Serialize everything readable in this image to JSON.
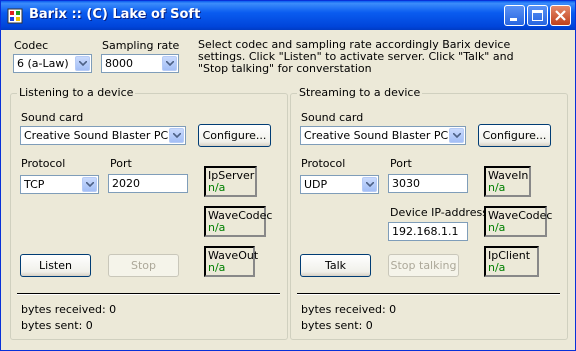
{
  "window": {
    "title": "Barix ::  (C) Lake of Soft"
  },
  "top": {
    "codec_label": "Codec",
    "codec_value": "6 (a-Law)",
    "rate_label": "Sampling rate",
    "rate_value": "8000",
    "instructions": "Select codec and sampling rate accordingly Barix device settings. Click \"Listen\" to activate server. Click \"Talk\" and \"Stop talking\" for converstation"
  },
  "listen": {
    "title": "Listening to a device",
    "soundcard_label": "Sound card",
    "soundcard_value": "Creative Sound Blaster PCI",
    "configure": "Configure...",
    "protocol_label": "Protocol",
    "protocol_value": "TCP",
    "port_label": "Port",
    "port_value": "2020",
    "statuses": [
      {
        "name": "IpServer",
        "state": "n/a"
      },
      {
        "name": "WaveCodec",
        "state": "n/a"
      },
      {
        "name": "WaveOut",
        "state": "n/a"
      }
    ],
    "start_button": "Listen",
    "stop_button": "Stop",
    "bytes_received": "bytes received: 0",
    "bytes_sent": "bytes sent: 0"
  },
  "stream": {
    "title": "Streaming to a device",
    "soundcard_label": "Sound card",
    "soundcard_value": "Creative Sound Blaster PCI",
    "configure": "Configure...",
    "protocol_label": "Protocol",
    "protocol_value": "UDP",
    "port_label": "Port",
    "port_value": "3030",
    "ip_label": "Device IP-address",
    "ip_value": "192.168.1.1",
    "statuses": [
      {
        "name": "WaveIn",
        "state": "n/a"
      },
      {
        "name": "WaveCodec",
        "state": "n/a"
      },
      {
        "name": "IpClient",
        "state": "n/a"
      }
    ],
    "start_button": "Talk",
    "stop_button": "Stop talking",
    "bytes_received": "bytes received: 0",
    "bytes_sent": "bytes sent: 0"
  },
  "icons": [
    "app-icon",
    "minimize-icon",
    "maximize-icon",
    "close-icon",
    "chevron-down-icon"
  ]
}
